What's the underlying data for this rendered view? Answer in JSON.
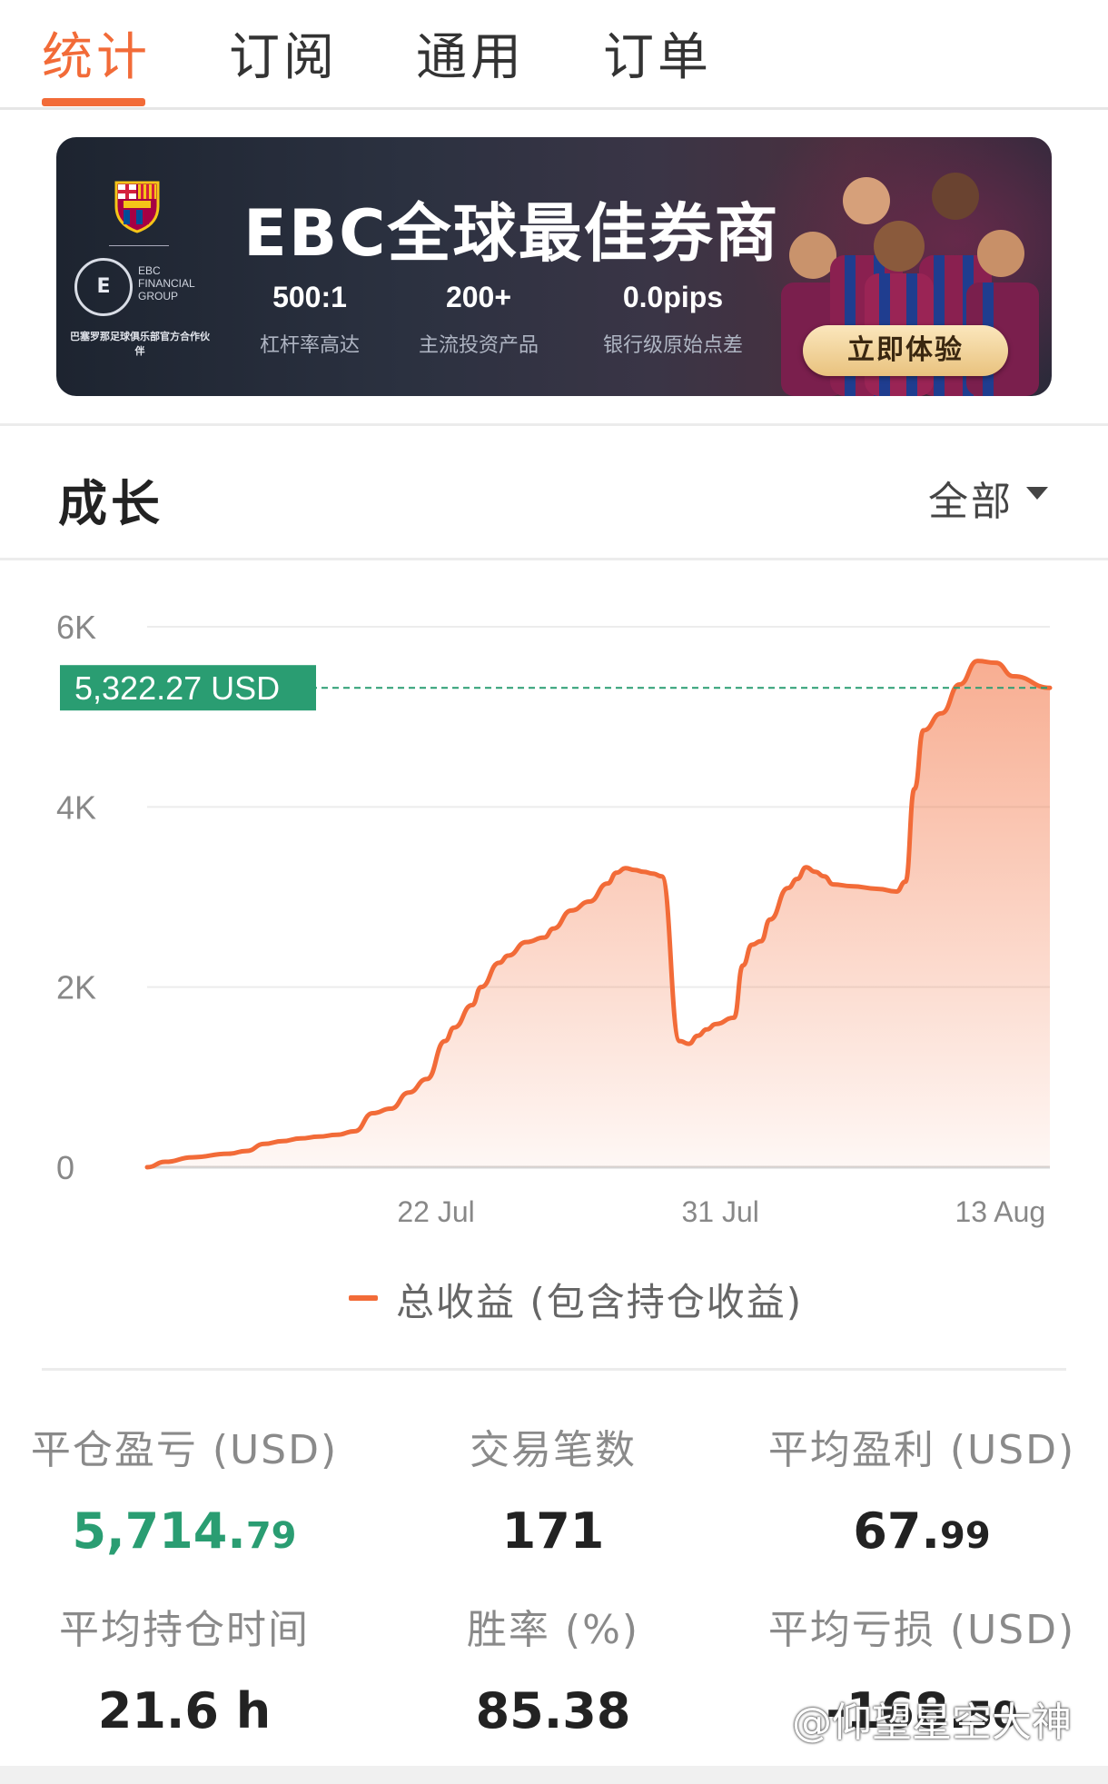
{
  "tabs": [
    {
      "label": "统计",
      "active": true
    },
    {
      "label": "订阅",
      "active": false
    },
    {
      "label": "通用",
      "active": false
    },
    {
      "label": "订单",
      "active": false
    }
  ],
  "banner": {
    "title": "EBC全球最佳券商",
    "logo_text": "EBC FINANCIAL GROUP",
    "partner_text": "巴塞罗那足球俱乐部官方合作伙伴",
    "stats": [
      {
        "value": "500:1",
        "desc": "杠杆率高达"
      },
      {
        "value": "200+",
        "desc": "主流投资产品"
      },
      {
        "value": "0.0pips",
        "desc": "银行级原始点差"
      }
    ],
    "cta": "立即体验",
    "colors": {
      "cta": "#f1d39c",
      "background": "#2b3140"
    }
  },
  "growth": {
    "title": "成长",
    "range_label": "全部"
  },
  "chart_data": {
    "type": "area",
    "y_tick_labels": [
      "0",
      "2K",
      "4K",
      "6K"
    ],
    "ylim": [
      0,
      6000
    ],
    "x_tick_labels": [
      "22 Jul",
      "31 Jul",
      "13 Aug"
    ],
    "current_value_label": "5,322.27 USD",
    "current_value": 5322.27,
    "series": [
      {
        "name": "总收益 (包含持仓收益)",
        "color": "#f26b38",
        "x": [
          0,
          0.02,
          0.05,
          0.09,
          0.11,
          0.13,
          0.15,
          0.17,
          0.19,
          0.21,
          0.23,
          0.25,
          0.27,
          0.29,
          0.31,
          0.33,
          0.34,
          0.36,
          0.37,
          0.39,
          0.4,
          0.42,
          0.44,
          0.45,
          0.47,
          0.49,
          0.51,
          0.52,
          0.53,
          0.54,
          0.55,
          0.56,
          0.57,
          0.59,
          0.6,
          0.61,
          0.62,
          0.63,
          0.65,
          0.66,
          0.67,
          0.68,
          0.69,
          0.71,
          0.72,
          0.73,
          0.74,
          0.75,
          0.76,
          0.78,
          0.81,
          0.83,
          0.84,
          0.85,
          0.86,
          0.88,
          0.9,
          0.92,
          0.94,
          0.96,
          1.0
        ],
        "y": [
          0,
          60,
          110,
          150,
          180,
          260,
          290,
          320,
          340,
          360,
          400,
          600,
          650,
          830,
          980,
          1400,
          1550,
          1800,
          2000,
          2270,
          2350,
          2500,
          2550,
          2650,
          2850,
          2950,
          3150,
          3270,
          3320,
          3300,
          3280,
          3260,
          3230,
          1400,
          1370,
          1460,
          1530,
          1590,
          1660,
          2240,
          2470,
          2510,
          2750,
          3100,
          3200,
          3330,
          3280,
          3230,
          3140,
          3120,
          3090,
          3060,
          3170,
          4200,
          4850,
          5040,
          5360,
          5620,
          5600,
          5450,
          5322
        ]
      }
    ],
    "legend_position": "bottom",
    "grid": true
  },
  "stats": [
    {
      "label": "平仓盈亏 (USD)",
      "int": "5,714.",
      "dec": "79",
      "color": "#2a9d72"
    },
    {
      "label": "交易笔数",
      "int": "171",
      "dec": ""
    },
    {
      "label": "平均盈利 (USD)",
      "int": "67.",
      "dec": "99"
    },
    {
      "label": "平均持仓时间",
      "int": "21.6 h",
      "dec": ""
    },
    {
      "label": "胜率 (%)",
      "int": "85.38",
      "dec": ""
    },
    {
      "label": "平均亏损 (USD)",
      "int": "-168.",
      "dec": "50"
    }
  ],
  "watermark": "@仰望星空大神"
}
